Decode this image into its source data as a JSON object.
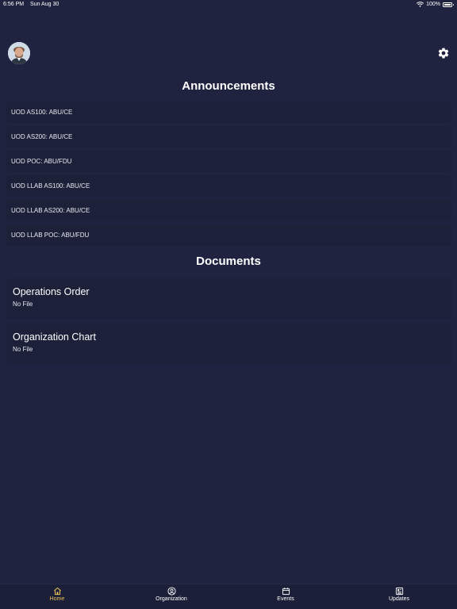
{
  "status_bar": {
    "time": "6:56 PM",
    "date": "Sun Aug 30",
    "battery": "100%"
  },
  "header": {
    "avatar_icon": "user-photo",
    "settings_icon": "gear-icon"
  },
  "announcements": {
    "title": "Announcements",
    "items": [
      {
        "label": "UOD AS100: ABU/CE"
      },
      {
        "label": "UOD AS200: ABU/CE"
      },
      {
        "label": "UOD POC: ABU/FDU"
      },
      {
        "label": "UOD LLAB AS100: ABU/CE"
      },
      {
        "label": "UOD LLAB AS200: ABU/CE"
      },
      {
        "label": "UOD LLAB POC: ABU/FDU"
      }
    ]
  },
  "documents": {
    "title": "Documents",
    "items": [
      {
        "title": "Operations Order",
        "status": "No File"
      },
      {
        "title": "Organization Chart",
        "status": "No File"
      }
    ]
  },
  "tabs": [
    {
      "label": "Home",
      "icon": "home-icon",
      "active": true
    },
    {
      "label": "Organization",
      "icon": "person-circle-icon",
      "active": false
    },
    {
      "label": "Events",
      "icon": "calendar-icon",
      "active": false
    },
    {
      "label": "Updates",
      "icon": "news-icon",
      "active": false
    }
  ],
  "colors": {
    "background": "#1f2340",
    "row": "#1c2039",
    "accent": "#e8c15a",
    "text": "#ffffff"
  }
}
